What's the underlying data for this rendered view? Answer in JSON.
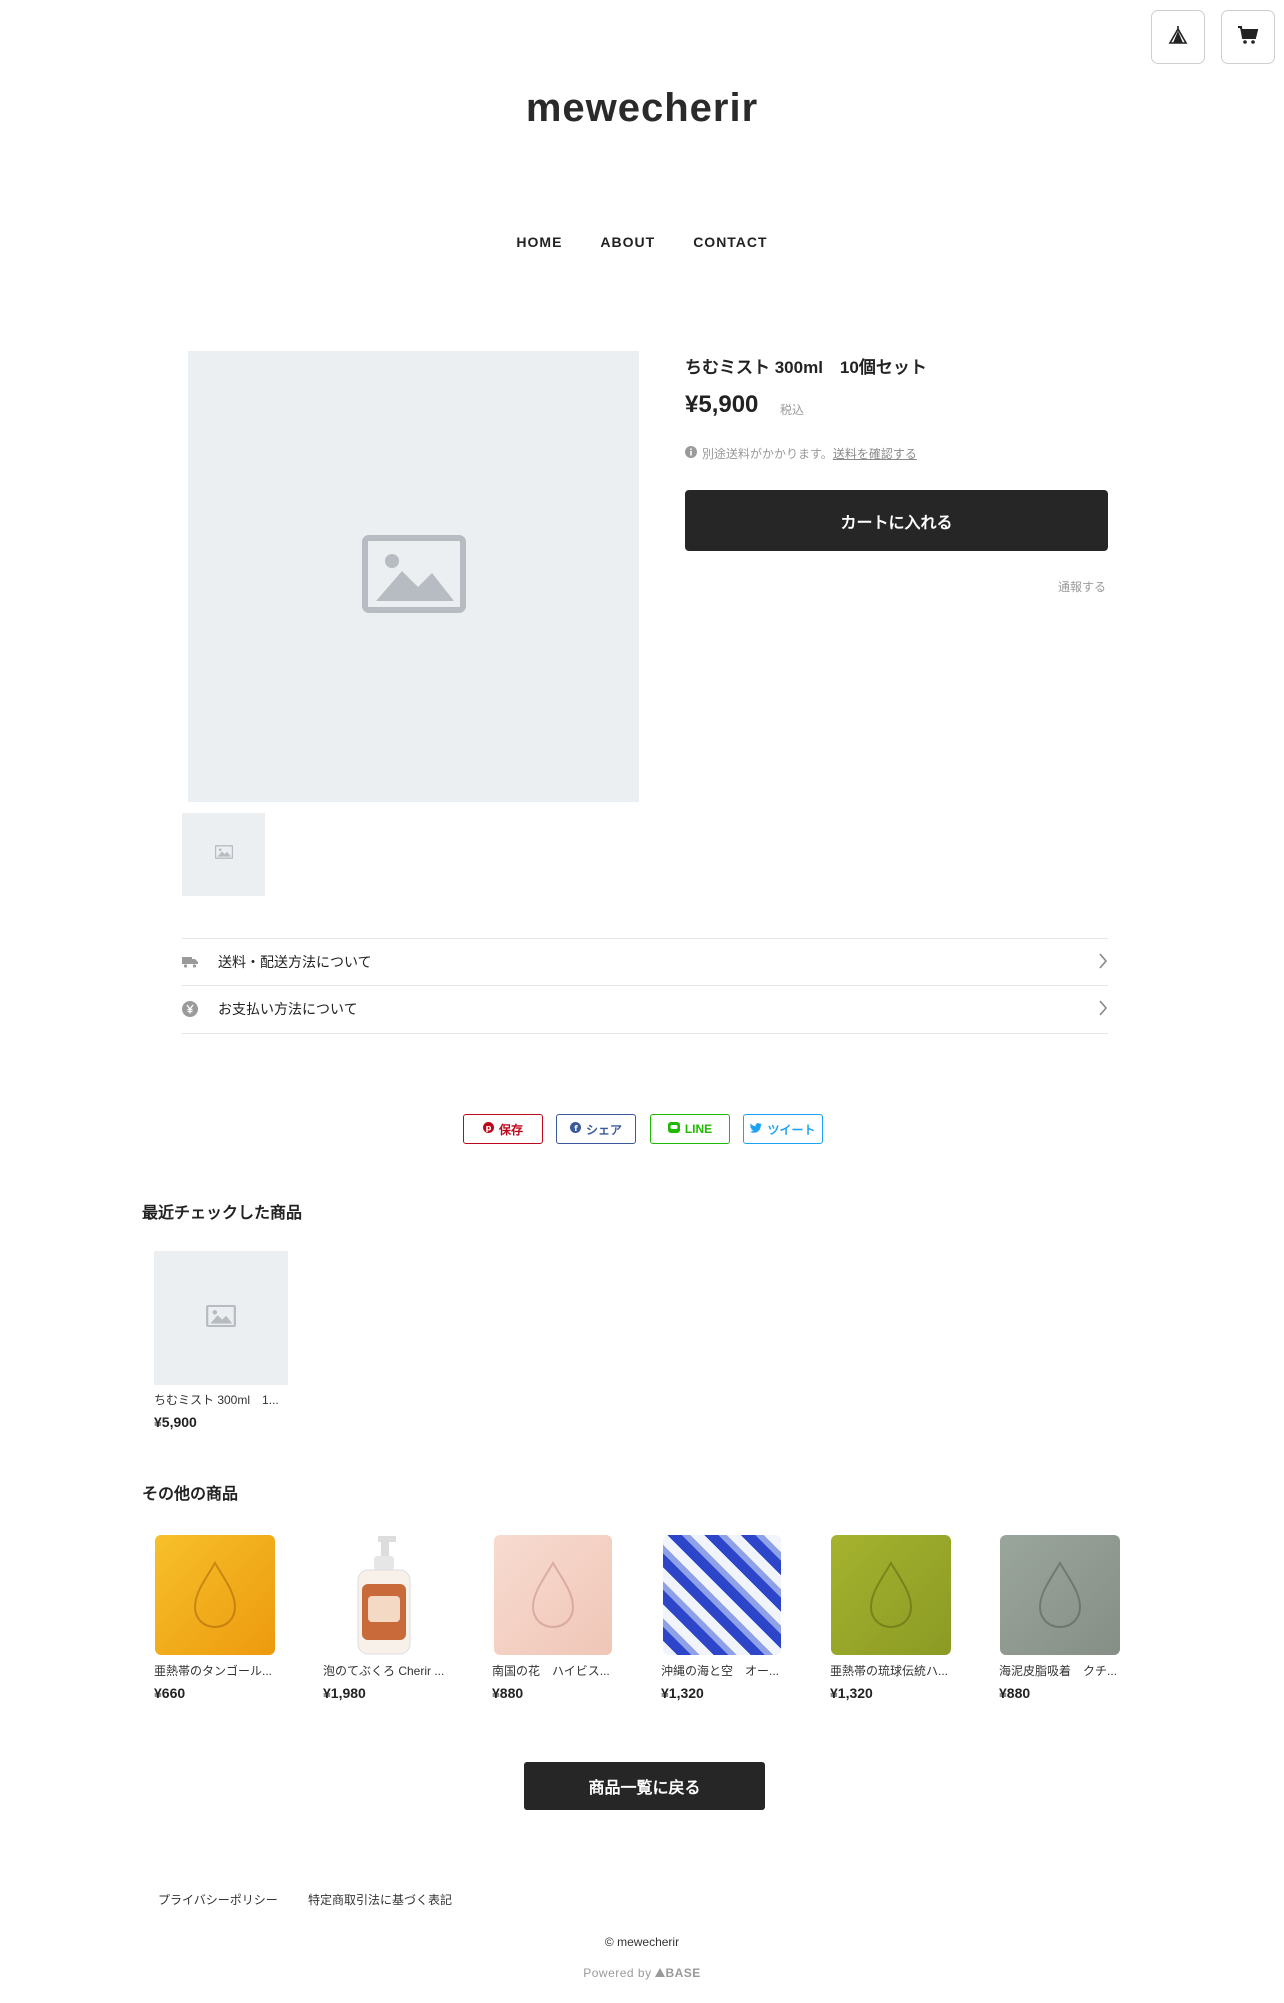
{
  "header": {
    "brand": "mewecherir",
    "nav": [
      "HOME",
      "ABOUT",
      "CONTACT"
    ]
  },
  "product": {
    "title": "ちむミスト 300ml　10個セット",
    "price": "¥5,900",
    "tax_label": "税込",
    "shipping_note": "別途送料がかかります。",
    "shipping_link": "送料を確認する",
    "cart_button": "カートに入れる",
    "report_link": "通報する"
  },
  "accordion": [
    {
      "label": "送料・配送方法について",
      "icon": "truck-icon"
    },
    {
      "label": "お支払い方法について",
      "icon": "yen-icon"
    }
  ],
  "share": {
    "pinterest": "保存",
    "facebook": "シェア",
    "line": "LINE",
    "twitter": "ツイート",
    "colors": {
      "pinterest": "#bd081c",
      "facebook": "#3b5998",
      "line": "#1eb900",
      "twitter": "#1da1f2"
    }
  },
  "recent": {
    "heading": "最近チェックした商品",
    "items": [
      {
        "name": "ちむミスト 300ml　1...",
        "price": "¥5,900"
      }
    ]
  },
  "others": {
    "heading": "その他の商品",
    "items": [
      {
        "name": "亜熱帯のタンゴール...",
        "price": "¥660",
        "color": "#f2a817"
      },
      {
        "name": "泡のてぶくろ Cherir ...",
        "price": "¥1,980",
        "color": "#c86a3a"
      },
      {
        "name": "南国の花　ハイビス...",
        "price": "¥880",
        "color": "#f3cfc3"
      },
      {
        "name": "沖縄の海と空　オー...",
        "price": "¥1,320",
        "color": "#2d46c9"
      },
      {
        "name": "亜熱帯の琉球伝統ハ...",
        "price": "¥1,320",
        "color": "#96a52b"
      },
      {
        "name": "海泥皮脂吸着　クチ...",
        "price": "¥880",
        "color": "#8f9a90"
      }
    ]
  },
  "back_button": "商品一覧に戻る",
  "footer": {
    "links": [
      "プライバシーポリシー",
      "特定商取引法に基づく表記"
    ],
    "copyright": "© mewecherir",
    "powered": "Powered by",
    "powered_brand": "BASE"
  }
}
